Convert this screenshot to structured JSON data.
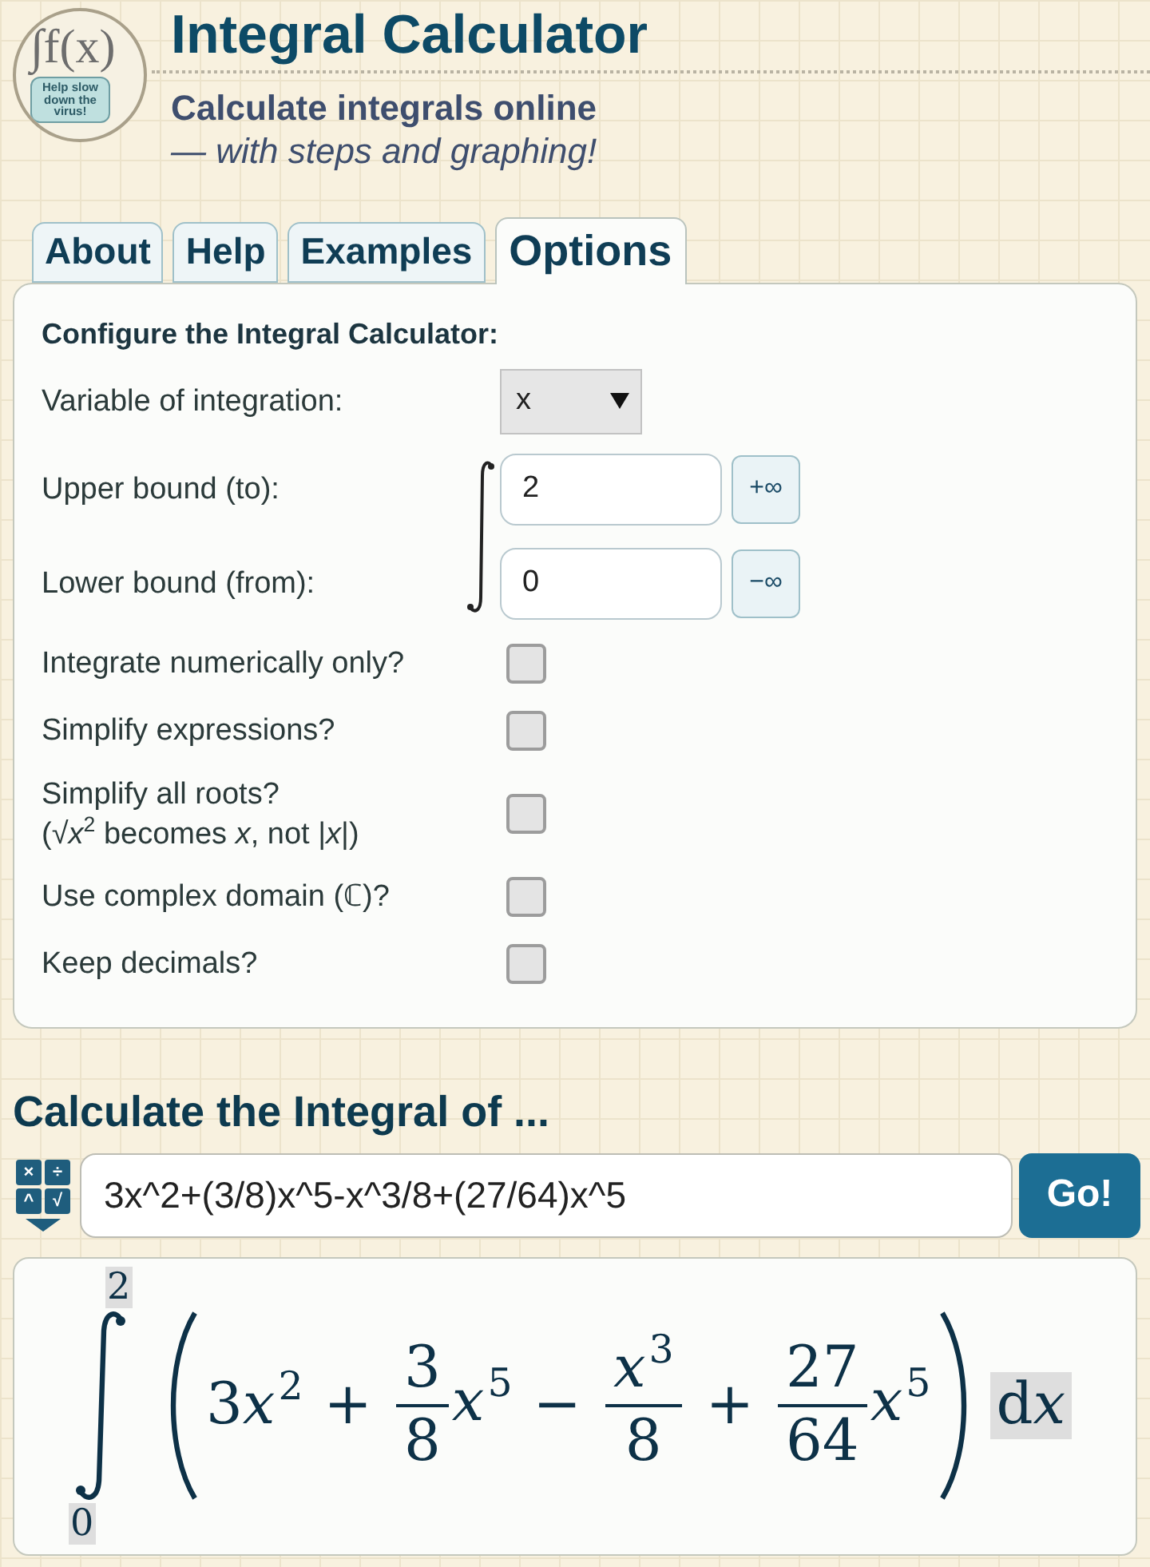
{
  "header": {
    "logo": {
      "symbol": "∫f(x)",
      "badge_text": "Help slow down the virus!"
    },
    "title": "Integral Calculator",
    "subtitle": "Calculate integrals online",
    "tagline": "— with steps and graphing!"
  },
  "tabs": [
    {
      "label": "About",
      "selected": false
    },
    {
      "label": "Help",
      "selected": false
    },
    {
      "label": "Examples",
      "selected": false
    },
    {
      "label": "Options",
      "selected": true
    }
  ],
  "options_panel": {
    "heading": "Configure the Integral Calculator:",
    "variable": {
      "label": "Variable of integration:",
      "value": "x"
    },
    "bounds": [
      {
        "label": "Upper bound (to):",
        "value": "2",
        "infinity_button": "+∞"
      },
      {
        "label": "Lower bound (from):",
        "value": "0",
        "infinity_button": "−∞"
      }
    ],
    "checkboxes": [
      {
        "label": "Integrate numerically only?",
        "checked": false
      },
      {
        "label": "Simplify expressions?",
        "checked": false
      },
      {
        "label": "Simplify all roots?",
        "note": "(√*x*$^{2}$ becomes *x*, not |*x*|)",
        "checked": false
      },
      {
        "label": "Use complex domain (ℂ)?",
        "checked": false
      },
      {
        "label": "Keep decimals?",
        "checked": false
      }
    ]
  },
  "calculate": {
    "heading": "Calculate the Integral of ...",
    "keypad_keys": [
      "×",
      "÷",
      "^",
      "√"
    ],
    "input_value": "3x^2+(3/8)x^5-x^3/8+(27/64)x^5",
    "go_button": "Go!"
  },
  "preview": {
    "upper_limit": "2",
    "lower_limit": "0",
    "terms": [
      {
        "kind": "monomial",
        "coefficient": "3",
        "variable": "x",
        "exponent": "2"
      },
      {
        "kind": "operator",
        "symbol": "+"
      },
      {
        "kind": "fraction_coefficient",
        "numerator": "3",
        "denominator": "8",
        "variable": "x",
        "exponent": "5"
      },
      {
        "kind": "operator",
        "symbol": "−"
      },
      {
        "kind": "power_fraction",
        "variable": "x",
        "exponent": "3",
        "denominator": "8"
      },
      {
        "kind": "operator",
        "symbol": "+"
      },
      {
        "kind": "fraction_coefficient",
        "numerator": "27",
        "denominator": "64",
        "variable": "x",
        "exponent": "5"
      }
    ],
    "differential": {
      "operator": "d",
      "variable": "x"
    }
  }
}
